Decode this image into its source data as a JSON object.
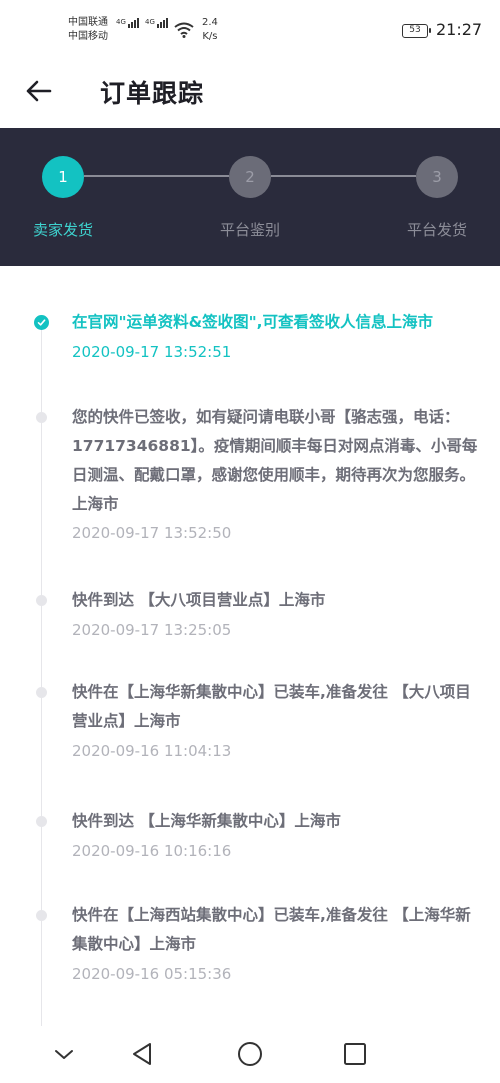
{
  "status_bar": {
    "carrier1": "中国联通",
    "carrier2": "中国移动",
    "network1": "4G",
    "network2": "4G",
    "speed_value": "2.4",
    "speed_unit": "K/s",
    "battery": "53",
    "time": "21:27"
  },
  "header": {
    "title": "订单跟踪"
  },
  "steps": [
    {
      "number": "1",
      "label": "卖家发货",
      "active": true
    },
    {
      "number": "2",
      "label": "平台鉴别",
      "active": false
    },
    {
      "number": "3",
      "label": "平台发货",
      "active": false
    }
  ],
  "events": [
    {
      "text": "在官网\"运单资料&签收图\",可查看签收人信息上海市",
      "time": "2020-09-17 13:52:51",
      "active": true
    },
    {
      "text": "您的快件已签收，如有疑问请电联小哥【骆志强，电话：17717346881】。疫情期间顺丰每日对网点消毒、小哥每日测温、配戴口罩，感谢您使用顺丰，期待再次为您服务。上海市",
      "time": "2020-09-17 13:52:50",
      "active": false
    },
    {
      "text": "快件到达 【大八项目营业点】上海市",
      "time": "2020-09-17 13:25:05",
      "active": false
    },
    {
      "text": "快件在【上海华新集散中心】已装车,准备发往 【大八项目营业点】上海市",
      "time": "2020-09-16 11:04:13",
      "active": false
    },
    {
      "text": "快件到达 【上海华新集散中心】上海市",
      "time": "2020-09-16 10:16:16",
      "active": false
    },
    {
      "text": "快件在【上海西站集散中心】已装车,准备发往 【上海华新集散中心】上海市",
      "time": "2020-09-16 05:15:36",
      "active": false
    }
  ],
  "colors": {
    "accent": "#13c2c2",
    "stepper_bg": "#2a2b3c"
  },
  "icons": {
    "back": "arrow-left-icon",
    "nav_down": "chevron-down-icon",
    "nav_back": "triangle-back-icon",
    "nav_home": "circle-home-icon",
    "nav_recent": "square-recent-icon"
  }
}
